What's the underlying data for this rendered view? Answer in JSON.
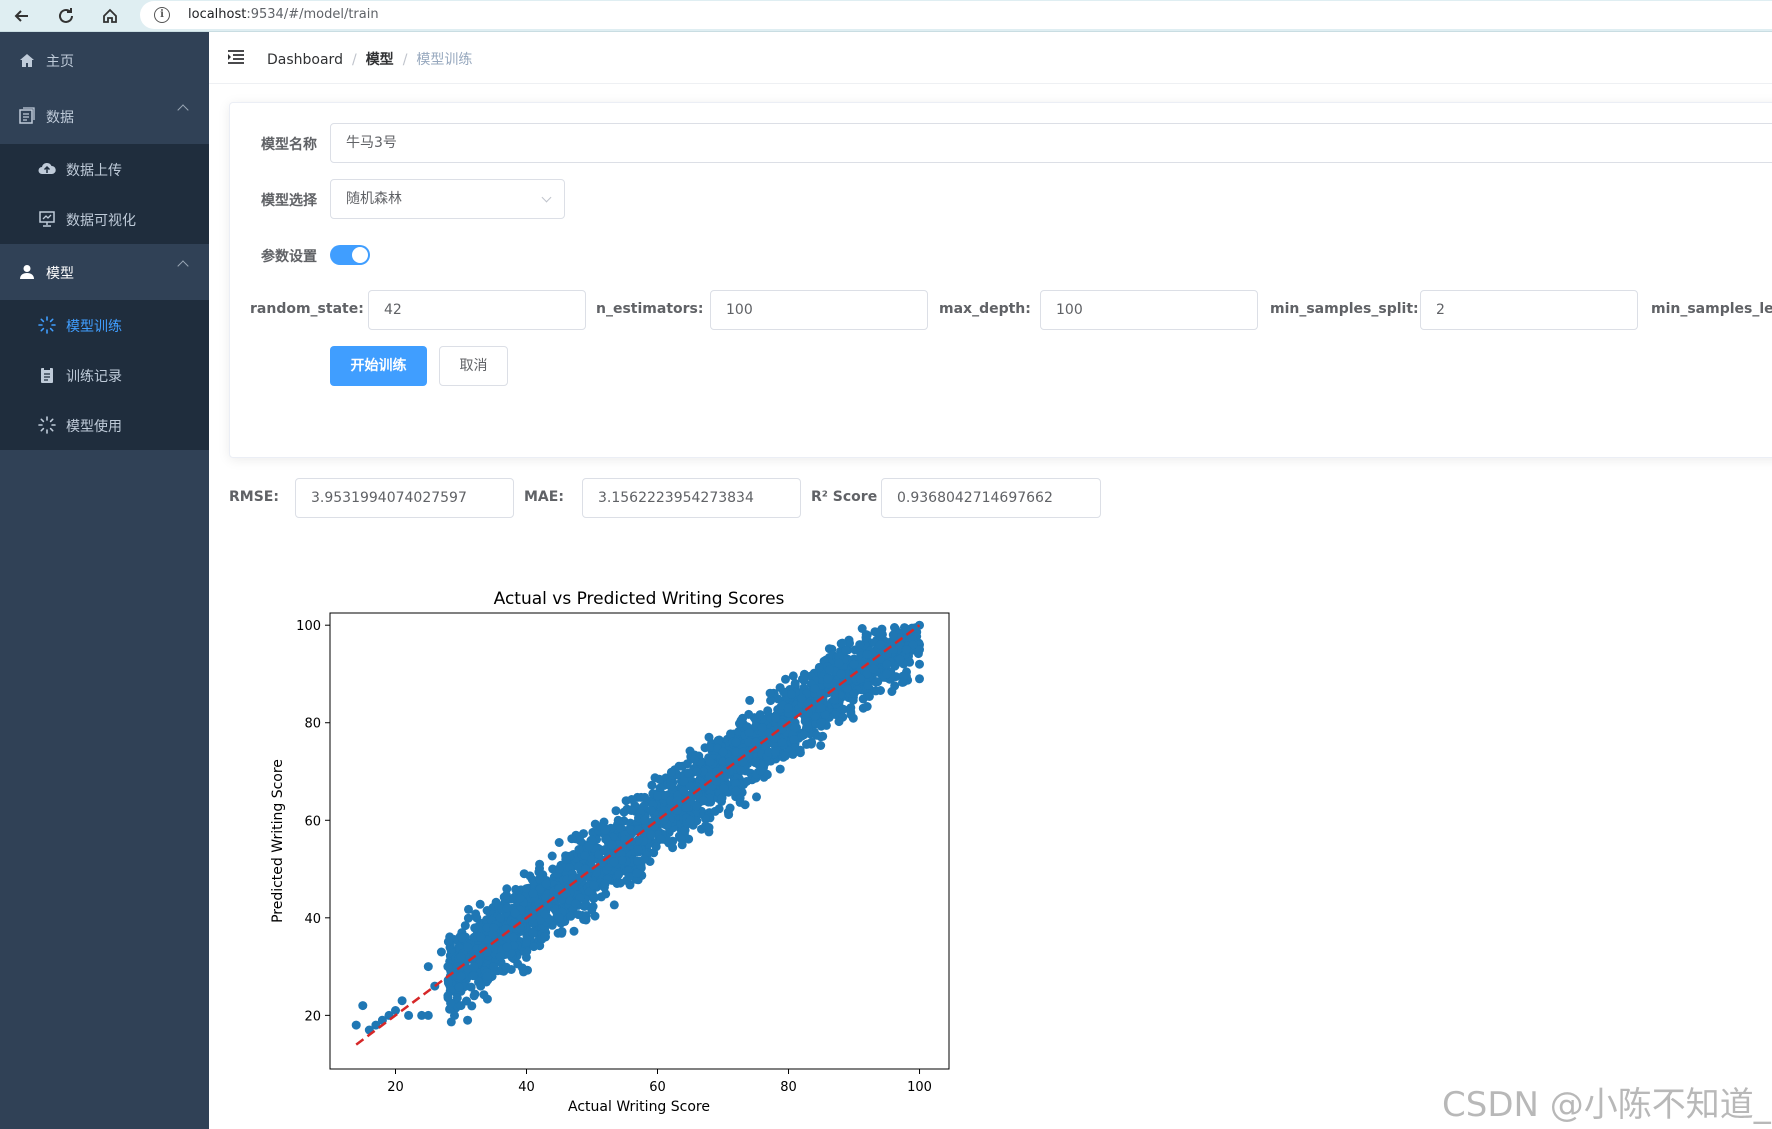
{
  "browser": {
    "url_host": "localhost",
    "url_rest": ":9534/#/model/train",
    "info_glyph": "i"
  },
  "sidebar": {
    "items": [
      {
        "label": "主页",
        "icon": "home-icon"
      },
      {
        "label": "数据",
        "icon": "data-icon"
      },
      {
        "label": "模型",
        "icon": "user-icon"
      }
    ],
    "data_sub": [
      {
        "label": "数据上传",
        "icon": "cloud-upload-icon"
      },
      {
        "label": "数据可视化",
        "icon": "chart-board-icon"
      }
    ],
    "model_sub": [
      {
        "label": "模型训练",
        "icon": "loading-icon",
        "active": true
      },
      {
        "label": "训练记录",
        "icon": "document-icon"
      },
      {
        "label": "模型使用",
        "icon": "loading-icon"
      }
    ],
    "bg_color": "#304156",
    "active_color": "#409eff"
  },
  "header": {
    "crumbs": [
      "Dashboard",
      "模型",
      "模型训练"
    ],
    "separator": "/"
  },
  "form": {
    "model_name_label": "模型名称",
    "model_name_value": "牛马3号",
    "model_select_label": "模型选择",
    "model_select_value": "随机森林",
    "params_label": "参数设置",
    "params_enabled": true,
    "params": [
      {
        "label": "random_state:",
        "value": "42"
      },
      {
        "label": "n_estimators:",
        "value": "100"
      },
      {
        "label": "max_depth:",
        "value": "100"
      },
      {
        "label": "min_samples_split:",
        "value": "2"
      },
      {
        "label": "min_samples_leaf",
        "value": ""
      }
    ],
    "start_button": "开始训练",
    "cancel_button": "取消"
  },
  "metrics": [
    {
      "label": "RMSE:",
      "value": "3.9531994074027597"
    },
    {
      "label": "MAE:",
      "value": "3.1562223954273834"
    },
    {
      "label": "R² Score",
      "value": "0.9368042714697662"
    }
  ],
  "chart_data": {
    "type": "scatter",
    "title": "Actual vs Predicted Writing Scores",
    "xlabel": "Actual Writing Score",
    "ylabel": "Predicted Writing Score",
    "xticks": [
      20,
      40,
      60,
      80,
      100
    ],
    "yticks": [
      20,
      40,
      60,
      80,
      100
    ],
    "xlim": [
      10,
      104.5
    ],
    "ylim": [
      9,
      102.5
    ],
    "point_color": "#1f77b4",
    "reference_line": {
      "x": [
        14,
        100
      ],
      "y": [
        14,
        100
      ],
      "color": "#d62728",
      "style": "dashed"
    },
    "x": [
      14,
      15,
      16,
      17,
      18,
      19,
      20,
      21,
      22,
      24,
      25,
      26,
      28,
      29,
      30,
      31,
      32,
      33,
      34,
      35,
      36,
      37,
      38,
      39,
      40,
      41,
      42,
      43,
      44,
      45,
      46,
      47,
      48,
      49,
      50,
      51,
      52,
      53,
      54,
      55,
      56,
      57,
      58,
      59,
      60,
      61,
      62,
      63,
      64,
      65,
      66,
      67,
      68,
      69,
      70,
      71,
      72,
      73,
      74,
      75,
      76,
      77,
      78,
      79,
      80,
      81,
      82,
      83,
      84,
      85,
      86,
      87,
      88,
      89,
      90,
      91,
      92,
      93,
      94,
      95,
      96,
      97,
      98,
      99,
      100,
      28,
      30,
      32,
      34,
      36,
      38,
      40,
      42,
      44,
      46,
      48,
      50,
      52,
      54,
      56,
      58,
      60,
      62,
      64,
      66,
      68,
      70,
      72,
      74,
      76,
      78,
      80,
      82,
      84,
      86,
      88,
      90,
      92,
      94,
      96,
      98,
      100,
      100,
      100,
      100,
      25,
      27,
      31,
      33,
      35,
      37,
      39,
      41,
      43,
      45,
      47,
      49,
      51,
      53,
      55,
      57,
      59,
      61,
      63,
      65,
      67,
      69,
      71,
      73,
      75,
      77,
      79,
      81,
      83,
      85,
      87,
      89,
      91,
      93,
      95,
      97,
      99,
      30,
      32,
      34,
      40,
      45,
      52,
      58,
      65,
      72,
      78,
      85,
      90,
      95,
      98
    ],
    "y": [
      18,
      22,
      17,
      18,
      19,
      20,
      21,
      23,
      20,
      20,
      20,
      26,
      24,
      20,
      22,
      19,
      24,
      26,
      28,
      30,
      32,
      34,
      36,
      38,
      40,
      39,
      42,
      44,
      44,
      46,
      45,
      49,
      48,
      50,
      52,
      52,
      54,
      55,
      55,
      57,
      58,
      58,
      60,
      62,
      60,
      62,
      64,
      64,
      66,
      67,
      66,
      70,
      69,
      70,
      72,
      72,
      74,
      74,
      76,
      76,
      78,
      78,
      80,
      80,
      82,
      80,
      84,
      84,
      86,
      86,
      88,
      88,
      88,
      90,
      90,
      92,
      90,
      92,
      93,
      94,
      95,
      96,
      95,
      97,
      100,
      30,
      32,
      36,
      38,
      40,
      44,
      46,
      48,
      50,
      52,
      54,
      56,
      58,
      60,
      62,
      63,
      65,
      67,
      68,
      70,
      72,
      74,
      76,
      78,
      79,
      81,
      83,
      85,
      87,
      89,
      90,
      92,
      94,
      96,
      98,
      99,
      96,
      92,
      89,
      95,
      30,
      33,
      34,
      36,
      38,
      42,
      44,
      45,
      47,
      50,
      48,
      50,
      53,
      55,
      56,
      54,
      57,
      60,
      62,
      64,
      64,
      68,
      70,
      72,
      72,
      74,
      76,
      79,
      82,
      83,
      86,
      87,
      89,
      91,
      92,
      93,
      96,
      28,
      30,
      33,
      35,
      40,
      47,
      52,
      60,
      66,
      74,
      80,
      86,
      90,
      95
    ]
  }
}
